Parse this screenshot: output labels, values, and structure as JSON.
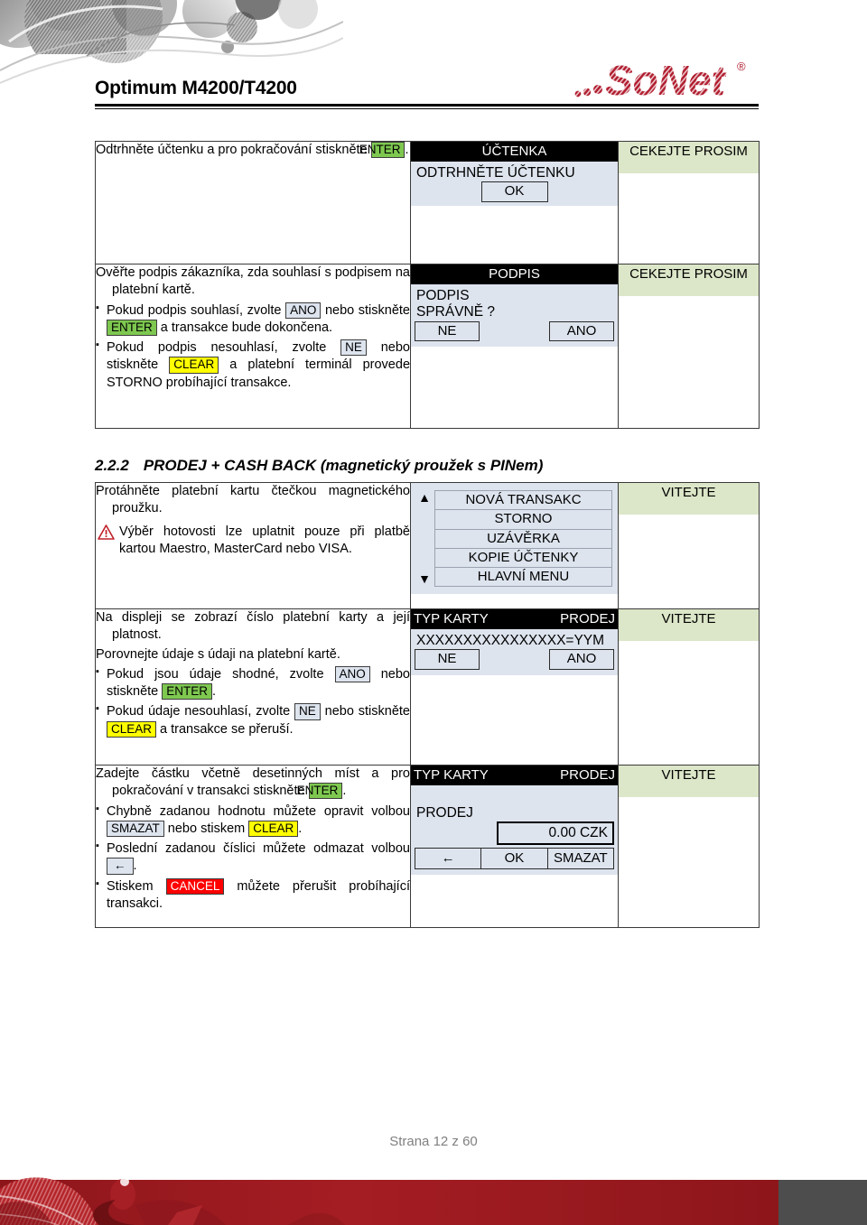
{
  "header": {
    "doc_title": "Optimum M4200/T4200",
    "logo_text": "SoNet",
    "logo_reg_mark": "®",
    "logo_color": "#b01c2e"
  },
  "colors": {
    "key_enter_bg": "#7ec850",
    "key_clear_bg": "#ffff00",
    "key_cancel_bg": "#ff0000",
    "key_plain_bg": "#dde4ee",
    "state_badge_bg": "#dce6c8",
    "screen_bg": "#dde4ee",
    "screen_bar_bg": "#000000",
    "brand_red": "#b01c2e",
    "footer_band_red": "#9d1b20",
    "footer_band_gray": "#4d4d4d"
  },
  "section": {
    "number": "2.2.2",
    "title": "PRODEJ + CASH BACK (magnetický proužek s PINem)"
  },
  "rows": [
    {
      "id": "row-tear-receipt",
      "desc": {
        "lead": "Odtrhněte účtenku a pro pokračování stiskněte",
        "lead_key": "ENTER",
        "lead_tail": "."
      },
      "display": {
        "bar_title": "ÚČTENKA",
        "body_lines": [
          "ODTRHNĚTE ÚČTENKU"
        ],
        "ok_button": "OK"
      },
      "state": "CEKEJTE PROSIM"
    },
    {
      "id": "row-verify-signature",
      "desc": {
        "lead": "Ověřte podpis zákazníka, zda souhlasí s podpisem na platební kartě.",
        "bullets": [
          {
            "parts": [
              {
                "t": "text",
                "v": "Pokud podpis souhlasí, zvolte "
              },
              {
                "t": "key",
                "v": "ANO",
                "style": "plain"
              },
              {
                "t": "text",
                "v": " nebo stiskněte "
              },
              {
                "t": "key",
                "v": "ENTER",
                "style": "enter"
              },
              {
                "t": "text",
                "v": " a transakce bude dokončena."
              }
            ]
          },
          {
            "parts": [
              {
                "t": "text",
                "v": "Pokud podpis nesouhlasí, zvolte "
              },
              {
                "t": "key",
                "v": "NE",
                "style": "plain"
              },
              {
                "t": "text",
                "v": " nebo stiskněte "
              },
              {
                "t": "key",
                "v": "CLEAR",
                "style": "clear"
              },
              {
                "t": "text",
                "v": " a platební terminál provede STORNO probíhající transakce."
              }
            ]
          }
        ]
      },
      "display": {
        "bar_title": "PODPIS",
        "body_lines": [
          "PODPIS",
          "SPRÁVNĚ ?"
        ],
        "footer_left": "NE",
        "footer_right": "ANO"
      },
      "state": "CEKEJTE PROSIM"
    },
    {
      "id": "row-swipe-card",
      "desc": {
        "lead": "Protáhněte platební kartu čtečkou magnetického proužku.",
        "warning": "Výběr hotovosti lze uplatnit pouze při platbě kartou Maestro, MasterCard nebo VISA."
      },
      "display": {
        "menu_up": "▲",
        "menu_down": "▼",
        "menu_items": [
          "NOVÁ TRANSAKC",
          "STORNO",
          "UZÁVĚRKA",
          "KOPIE ÚČTENKY",
          "HLAVNÍ MENU"
        ]
      },
      "state": "VITEJTE"
    },
    {
      "id": "row-card-number",
      "desc": {
        "lead": "Na displeji se zobrazí číslo platební karty a její platnost.",
        "lead2": "Porovnejte údaje s údaji na platební kartě.",
        "bullets": [
          {
            "parts": [
              {
                "t": "text",
                "v": "Pokud jsou údaje shodné, zvolte "
              },
              {
                "t": "key",
                "v": "ANO",
                "style": "plain"
              },
              {
                "t": "text",
                "v": " nebo stiskněte "
              },
              {
                "t": "key",
                "v": "ENTER",
                "style": "enter"
              },
              {
                "t": "text",
                "v": "."
              }
            ]
          },
          {
            "parts": [
              {
                "t": "text",
                "v": "Pokud údaje nesouhlasí, zvolte "
              },
              {
                "t": "key",
                "v": "NE",
                "style": "plain"
              },
              {
                "t": "text",
                "v": " nebo stiskněte "
              },
              {
                "t": "key",
                "v": "CLEAR",
                "style": "clear"
              },
              {
                "t": "text",
                "v": " a transakce se přeruší."
              }
            ]
          }
        ]
      },
      "display": {
        "bar_left": "TYP KARTY",
        "bar_right": "PRODEJ",
        "body_lines": [
          "XXXXXXXXXXXXXXXX=YYM"
        ],
        "footer_left": "NE",
        "footer_right": "ANO"
      },
      "state": "VITEJTE"
    },
    {
      "id": "row-enter-amount",
      "desc": {
        "lead_parts": [
          {
            "t": "text",
            "v": "Zadejte částku včetně desetinných míst a pro pokračování v transakci stiskněte "
          },
          {
            "t": "key",
            "v": "ENTER",
            "style": "enter"
          },
          {
            "t": "text",
            "v": "."
          }
        ],
        "bullets": [
          {
            "parts": [
              {
                "t": "text",
                "v": "Chybně zadanou hodnotu můžete opravit volbou "
              },
              {
                "t": "key",
                "v": "SMAZAT",
                "style": "plain"
              },
              {
                "t": "text",
                "v": " nebo stiskem "
              },
              {
                "t": "key",
                "v": "CLEAR",
                "style": "clear"
              },
              {
                "t": "text",
                "v": "."
              }
            ]
          },
          {
            "parts": [
              {
                "t": "text",
                "v": "Poslední zadanou číslici můžete odmazat volbou "
              },
              {
                "t": "key",
                "v": "←",
                "style": "arrow"
              },
              {
                "t": "text",
                "v": "."
              }
            ]
          },
          {
            "parts": [
              {
                "t": "text",
                "v": "Stiskem "
              },
              {
                "t": "key",
                "v": "CANCEL",
                "style": "cancel"
              },
              {
                "t": "text",
                "v": " můžete přerušit probíhající transakci."
              }
            ]
          }
        ]
      },
      "display": {
        "bar_left": "TYP KARTY",
        "bar_right": "PRODEJ",
        "body_lines": [
          "PRODEJ"
        ],
        "amount_value": "0.00 CZK",
        "buttons": [
          "←",
          "OK",
          "SMAZAT"
        ]
      },
      "state": "VITEJTE"
    }
  ],
  "footer": {
    "page_label": "Strana 12 z 60"
  }
}
